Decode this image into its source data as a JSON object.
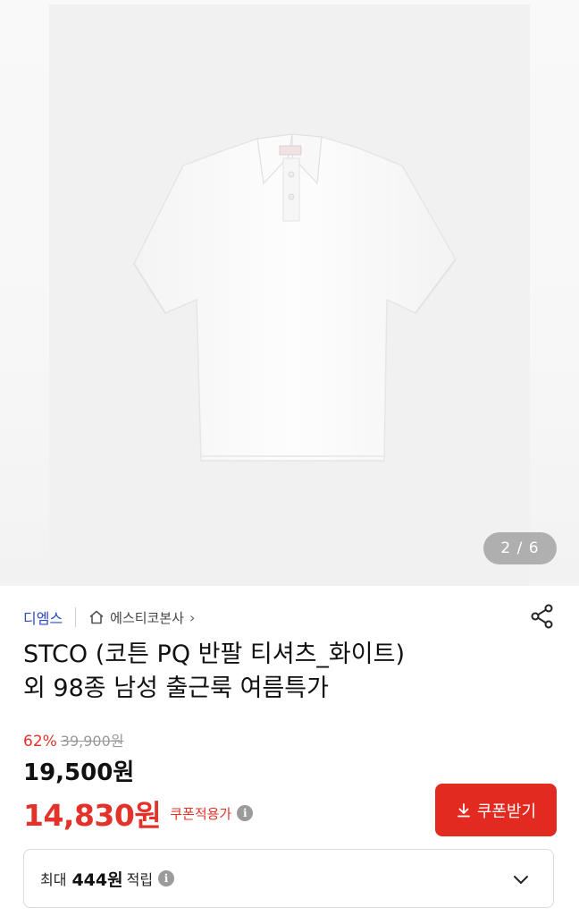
{
  "gallery": {
    "image_alt": "white polo shirt",
    "page_indicator": "2 / 6"
  },
  "seller": {
    "name": "디엠스",
    "brand_link": "에스티코본사"
  },
  "product": {
    "title_line1": "STCO (코튼 PQ 반팔 티셔츠_화이트)",
    "title_line2": "외 98종 남성 출근룩 여름특가"
  },
  "pricing": {
    "discount_rate": "62%",
    "original_price": "39,900원",
    "sale_price": "19,500원",
    "coupon_price": "14,830원",
    "coupon_label": "쿠폰적용가",
    "coupon_button_label": "쿠폰받기"
  },
  "points": {
    "prefix": "최대",
    "amount": "444원",
    "suffix": "적립"
  },
  "colors": {
    "accent_red": "#e22a21",
    "seller_blue": "#2d4cc8"
  },
  "icons": {
    "home": "home-icon",
    "share": "share-icon",
    "info": "info-icon",
    "download": "download-icon",
    "chevron": "chevron-down-icon"
  }
}
